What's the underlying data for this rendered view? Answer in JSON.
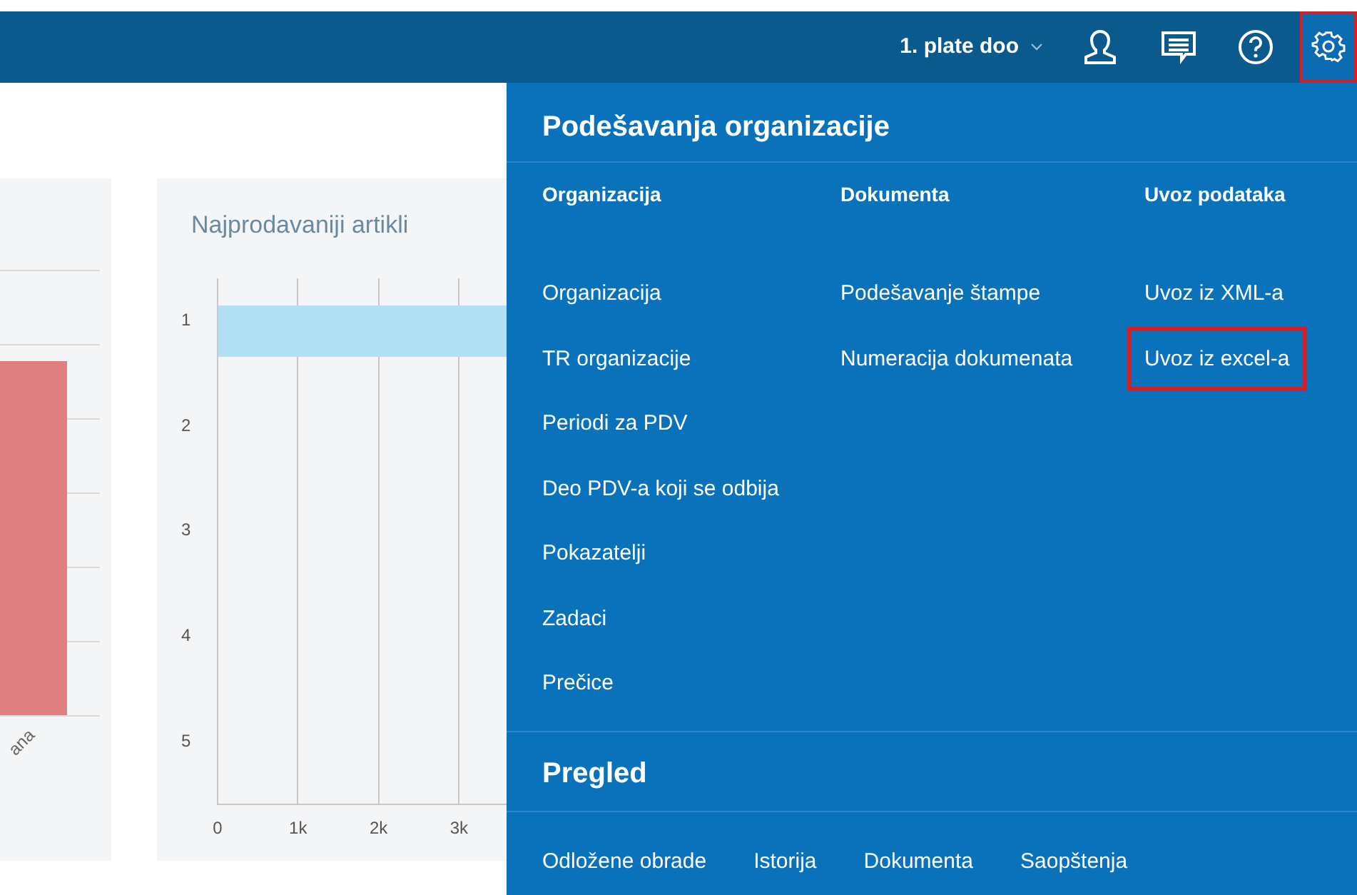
{
  "top_bar": {
    "organization": "1. plate doo",
    "settings_highlighted": true
  },
  "left_chart": {
    "x_label": "ana"
  },
  "top_products_chart": {
    "title": "Najprodavaniji artikli",
    "categories": [
      "1",
      "2",
      "3",
      "4",
      "5"
    ],
    "x_labels": [
      "0",
      "1k",
      "2k",
      "3k"
    ]
  },
  "settings_menu": {
    "title": "Podešavanja organizacije",
    "columns": [
      {
        "heading": "Organizacija",
        "items": [
          {
            "label": "Organizacija",
            "highlighted": false
          },
          {
            "label": "TR organizacije",
            "highlighted": false
          },
          {
            "label": "Periodi za PDV",
            "highlighted": false
          },
          {
            "label": "Deo PDV-a koji se odbija",
            "highlighted": false
          },
          {
            "label": "Pokazatelji",
            "highlighted": false
          },
          {
            "label": "Zadaci",
            "highlighted": false
          },
          {
            "label": "Prečice",
            "highlighted": false
          }
        ]
      },
      {
        "heading": "Dokumenta",
        "items": [
          {
            "label": "Podešavanje štampe",
            "highlighted": false
          },
          {
            "label": "Numeracija dokumenata",
            "highlighted": false
          }
        ]
      },
      {
        "heading": "Uvoz podataka",
        "items": [
          {
            "label": "Uvoz iz XML-a",
            "highlighted": false
          },
          {
            "label": "Uvoz iz excel-a",
            "highlighted": true
          }
        ]
      }
    ],
    "overview": {
      "title": "Pregled",
      "links": [
        "Odložene obrade",
        "Istorija",
        "Dokumenta",
        "Saopštenja"
      ]
    }
  }
}
